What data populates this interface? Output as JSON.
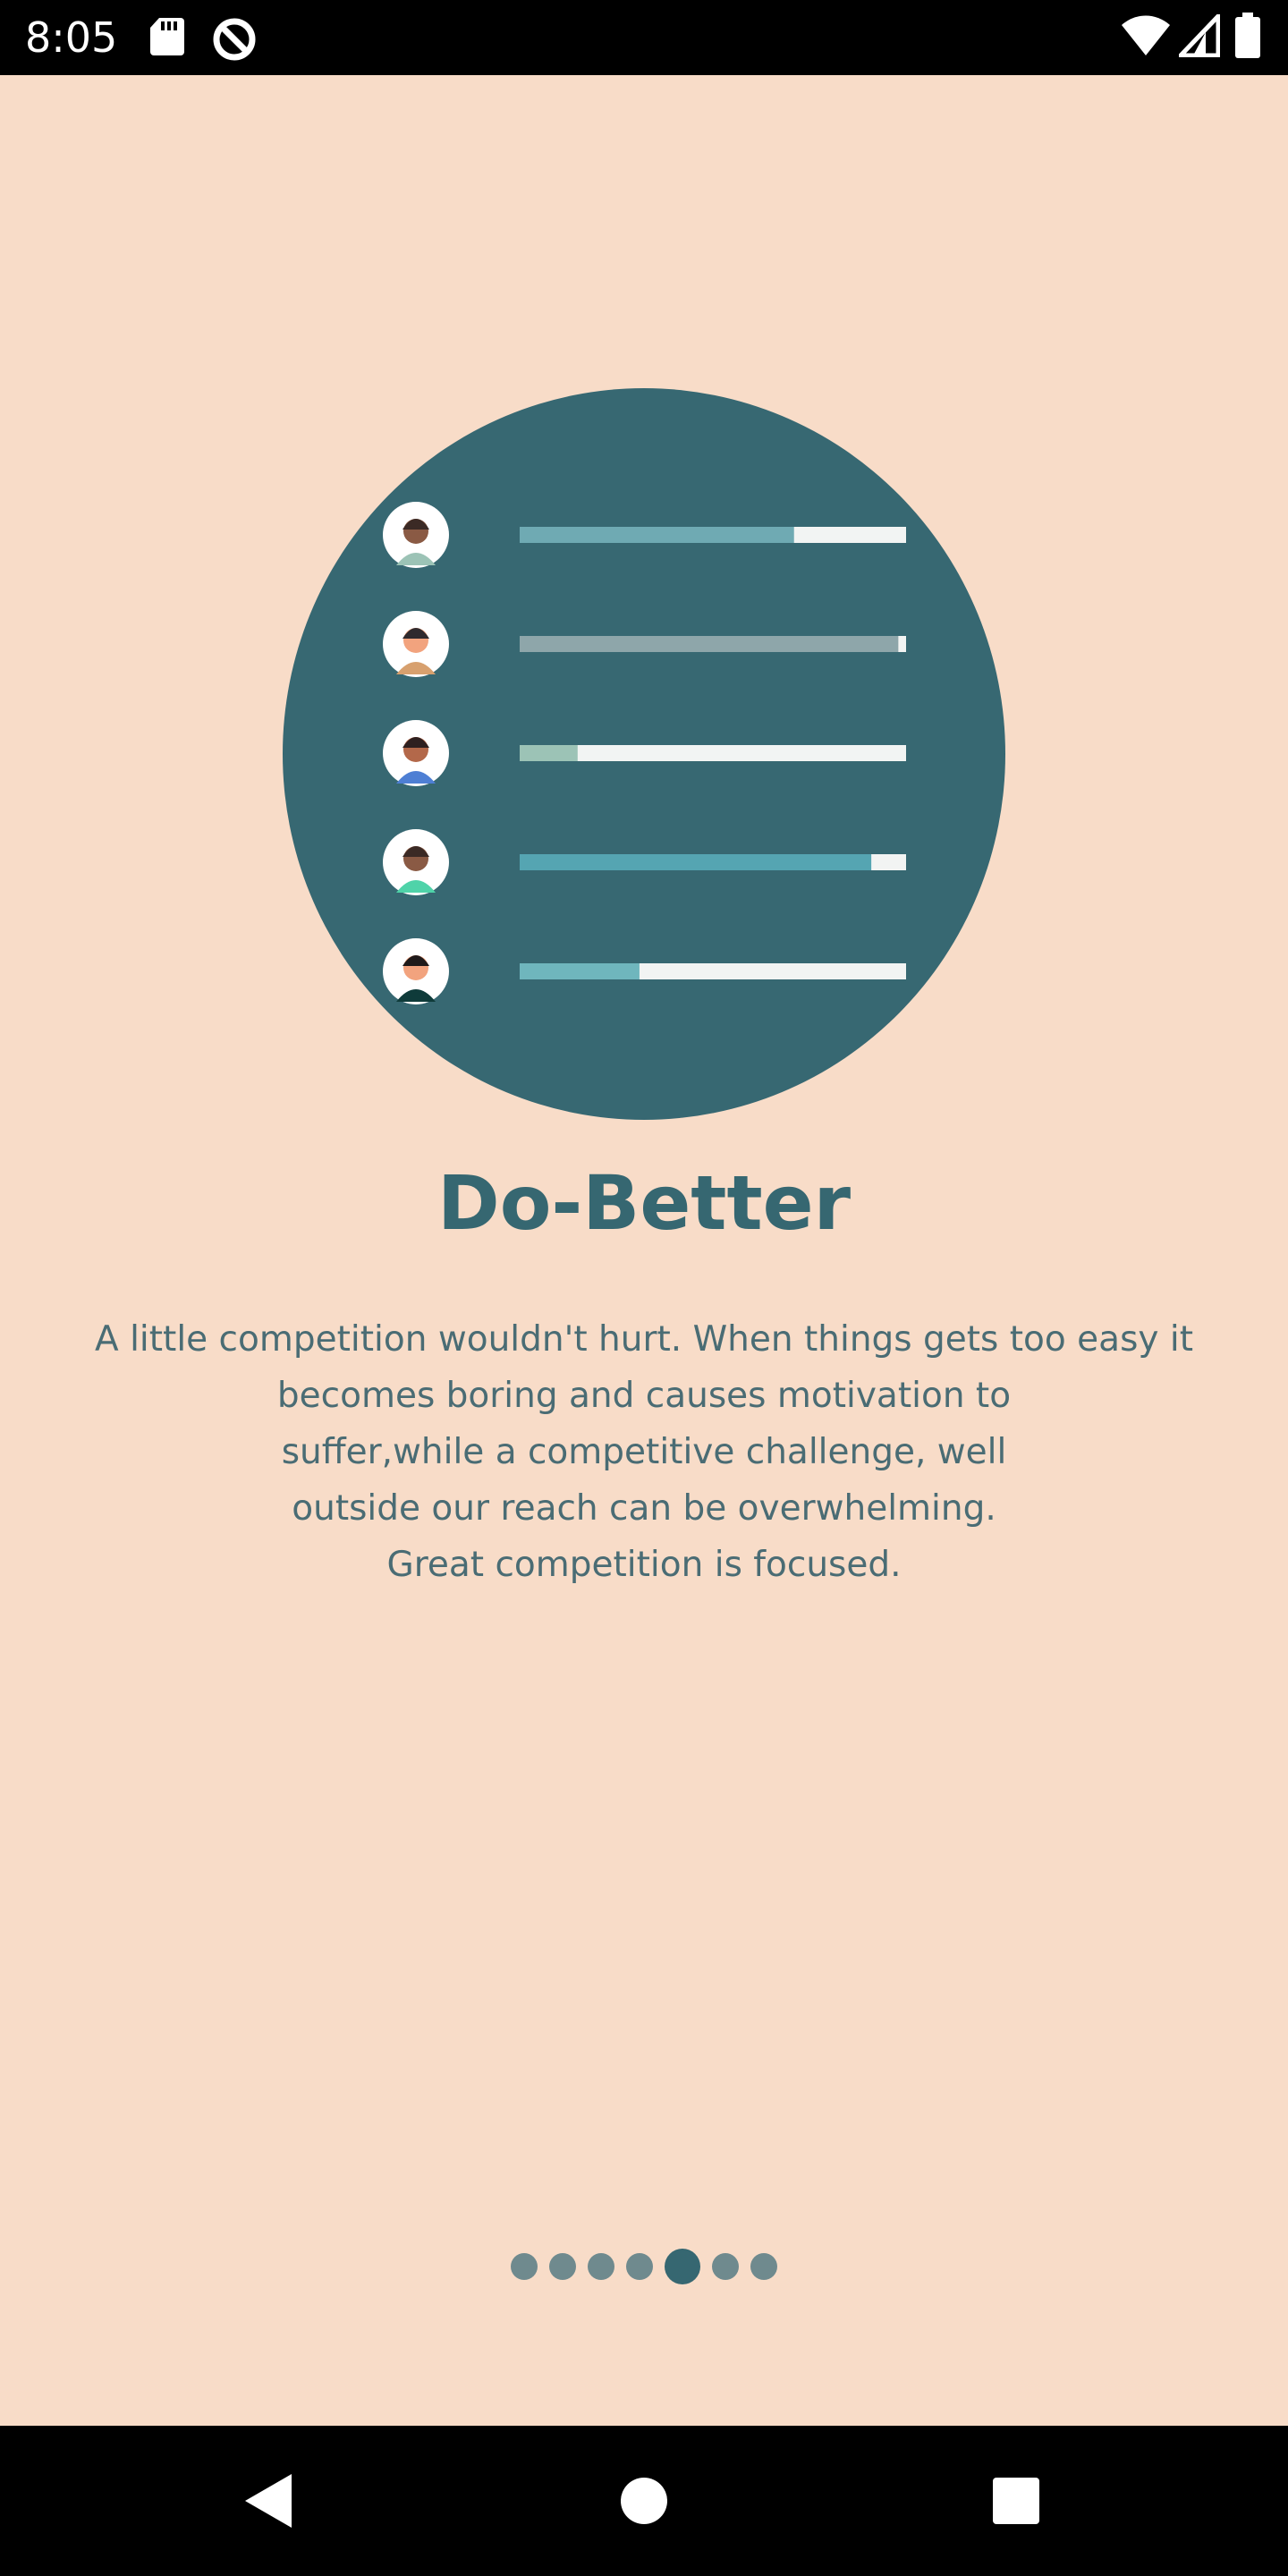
{
  "status_bar": {
    "time": "8:05",
    "icons": [
      "sd-card-icon",
      "data-saver-icon",
      "wifi-icon",
      "signal-icon",
      "battery-icon"
    ]
  },
  "hero": {
    "circle_color": "#376872",
    "rows": [
      {
        "avatar": "avatar-woman-long-hair",
        "progress": 0.71,
        "fill_color": "#6FAAB3"
      },
      {
        "avatar": "avatar-woman-bob",
        "progress": 0.98,
        "fill_color": "#8EA6AA"
      },
      {
        "avatar": "avatar-man-dark-skin",
        "progress": 0.15,
        "fill_color": "#9CC3B6"
      },
      {
        "avatar": "avatar-woman-curly",
        "progress": 0.91,
        "fill_color": "#55A5B2"
      },
      {
        "avatar": "avatar-man-light-skin",
        "progress": 0.31,
        "fill_color": "#6FB6BD"
      }
    ]
  },
  "title": "Do-Better",
  "description_lines": [
    "A little competition wouldn't hurt. When things gets too easy it",
    "becomes boring and causes motivation to",
    "suffer,while a competitive challenge, well",
    "outside our reach can be overwhelming.",
    "Great competition is focused."
  ],
  "pager": {
    "count": 7,
    "active_index": 4
  },
  "nav_bar": [
    "back-icon",
    "home-icon",
    "recents-icon"
  ],
  "colors": {
    "background": "#F8DCC8",
    "accent": "#366771",
    "text": "#4A6C74"
  }
}
